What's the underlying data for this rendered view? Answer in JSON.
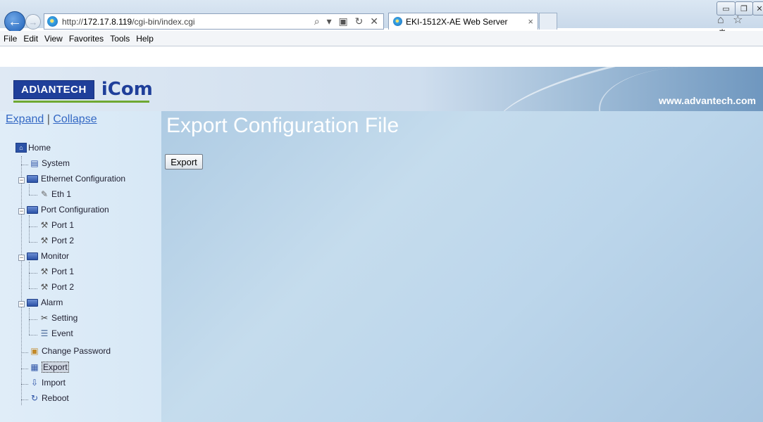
{
  "browser": {
    "address_prefix": "http://",
    "address_host": "172.17.8.119",
    "address_path": "/cgi-bin/index.cgi",
    "tab_title": "EKI-1512X-AE Web Server",
    "tab_close": "×",
    "address_tools": "⌕ ▾ ▣ ↻ ✕",
    "chrome_icons": "⌂ ☆ ⚙",
    "window_min": "▭",
    "window_max": "❐",
    "window_close": "✕",
    "back": "←",
    "forward": "→"
  },
  "menubar": [
    "File",
    "Edit",
    "View",
    "Favorites",
    "Tools",
    "Help"
  ],
  "header": {
    "logo_advantech": "AD\\ANTECH",
    "logo_icom": "iCom",
    "website": "www.advantech.com"
  },
  "sidebar": {
    "expand": "Expand",
    "separator": "|",
    "collapse": "Collapse",
    "home": "Home",
    "system": "System",
    "ethernet_configuration": "Ethernet Configuration",
    "eth1": "Eth 1",
    "port_configuration": "Port Configuration",
    "port_config_port1": "Port 1",
    "port_config_port2": "Port 2",
    "monitor": "Monitor",
    "monitor_port1": "Port 1",
    "monitor_port2": "Port 2",
    "alarm": "Alarm",
    "alarm_setting": "Setting",
    "alarm_event": "Event",
    "change_password": "Change Password",
    "export": "Export",
    "import": "Import",
    "reboot": "Reboot"
  },
  "content": {
    "title": "Export Configuration File",
    "export_button": "Export"
  },
  "icons": {
    "home": "home-icon",
    "system": "device-icon",
    "folder": "folder-icon",
    "eth": "pen-icon",
    "port": "wrench-icon",
    "setting": "tools-icon",
    "event": "event-icon",
    "password": "key-icon",
    "export": "export-icon",
    "import": "import-icon",
    "reboot": "reboot-icon"
  },
  "colors": {
    "link": "#3368c4",
    "brand": "#1f3f9a",
    "title_text": "#ffffff"
  }
}
